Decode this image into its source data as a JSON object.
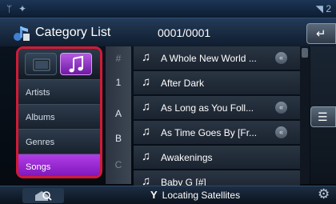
{
  "status_bar": {
    "right_text": "2"
  },
  "header": {
    "title": "Category List",
    "counter": "0001/0001"
  },
  "category_panel": {
    "tabs": [
      {
        "icon": "film-icon"
      },
      {
        "icon": "music-note-icon",
        "selected": true
      }
    ],
    "items": [
      {
        "label": "Artists"
      },
      {
        "label": "Albums"
      },
      {
        "label": "Genres"
      },
      {
        "label": "Songs",
        "selected": true
      }
    ],
    "accent": "#d21a35",
    "selected_color": "#b13de6"
  },
  "alpha_index": [
    "#",
    "1",
    "A",
    "B",
    "C"
  ],
  "songs": [
    {
      "title": "A Whole New World ...",
      "has_scroll_icon": true
    },
    {
      "title": "After Dark",
      "has_scroll_icon": false
    },
    {
      "title": "As Long as You Foll...",
      "has_scroll_icon": true
    },
    {
      "title": "As Time Goes By [Fr...",
      "has_scroll_icon": true
    },
    {
      "title": "Awakenings",
      "has_scroll_icon": false
    },
    {
      "title": "Baby G [#]",
      "has_scroll_icon": false
    }
  ],
  "scroll_icon_glyph": "«",
  "bottom_bar": {
    "gps_status": "Locating Satellites"
  }
}
